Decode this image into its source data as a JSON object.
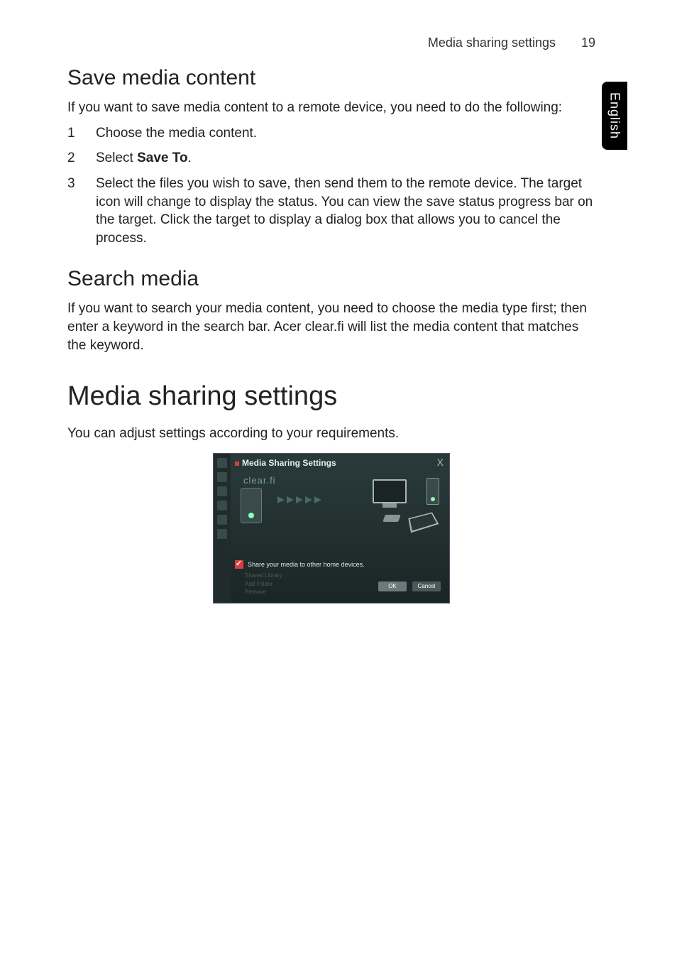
{
  "header": {
    "title": "Media sharing settings",
    "page_number": "19"
  },
  "side_tab": {
    "label": "English"
  },
  "section_save": {
    "title": "Save media content",
    "intro": "If you want to save media content to a remote device, you need to do the following:",
    "steps": [
      {
        "n": "1",
        "text_a": "Choose the media content."
      },
      {
        "n": "2",
        "text_a": "Select ",
        "bold": "Save To",
        "text_b": "."
      },
      {
        "n": "3",
        "text_a": "Select the files you wish to save, then send them to the remote device. The target icon will change to display the status. You can view the save status progress bar on the target. Click the target to display a dialog box that allows you to cancel the process."
      }
    ]
  },
  "section_search": {
    "title": "Search media",
    "body": "If you want to search your media content, you need to choose the media type first; then enter a keyword in the search bar. Acer clear.fi will list the media content that matches the keyword."
  },
  "section_settings": {
    "title": "Media sharing settings",
    "body": "You can adjust settings according to your requirements."
  },
  "screenshot": {
    "window_title": "Media Sharing Settings",
    "logo": "clear.fi",
    "checkbox_label": "Share your media to other home devices.",
    "ok_label": "OK",
    "cancel_label": "Cancel"
  }
}
